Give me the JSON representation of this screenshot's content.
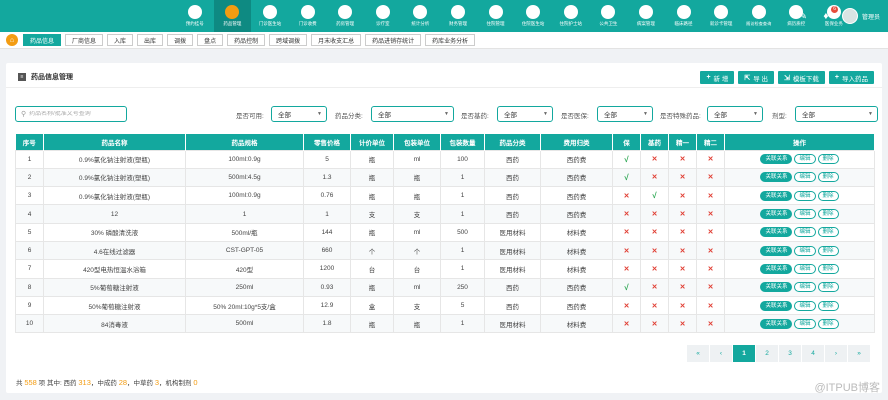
{
  "nav": {
    "items": [
      {
        "label": "预约挂号",
        "icon": "calendar-icon",
        "active": false
      },
      {
        "label": "药品管理",
        "icon": "medicine-icon",
        "active": true
      },
      {
        "label": "门诊医生站",
        "icon": "doctor-icon",
        "active": false
      },
      {
        "label": "门诊收费",
        "icon": "cashier-icon",
        "active": false
      },
      {
        "label": "药房管理",
        "icon": "pharmacy-icon",
        "active": false
      },
      {
        "label": "诊疗室",
        "icon": "clinic-icon",
        "active": false
      },
      {
        "label": "统计分析",
        "icon": "chart-icon",
        "active": false
      },
      {
        "label": "财务管理",
        "icon": "finance-icon",
        "active": false
      },
      {
        "label": "住院管理",
        "icon": "inpatient-icon",
        "active": false
      },
      {
        "label": "住院医生站",
        "icon": "ward-doctor-icon",
        "active": false
      },
      {
        "label": "住院护士站",
        "icon": "nurse-icon",
        "active": false
      },
      {
        "label": "公共卫生",
        "icon": "public-health-icon",
        "active": false
      },
      {
        "label": "病案管理",
        "icon": "records-icon",
        "active": false
      },
      {
        "label": "临床路径",
        "icon": "pathway-icon",
        "active": false
      },
      {
        "label": "就诊卡管理",
        "icon": "card-icon",
        "active": false
      },
      {
        "label": "随访检查查询",
        "icon": "followup-icon",
        "active": false
      },
      {
        "label": "病历质控",
        "icon": "quality-icon",
        "active": false
      },
      {
        "label": "医保业务",
        "icon": "insurance-icon",
        "active": false
      }
    ],
    "notification_count": "6",
    "username": "管理员"
  },
  "tabs": [
    {
      "label": "药品信息",
      "active": true
    },
    {
      "label": "厂商信息",
      "active": false
    },
    {
      "label": "入库",
      "active": false
    },
    {
      "label": "出库",
      "active": false
    },
    {
      "label": "调拨",
      "active": false
    },
    {
      "label": "盘点",
      "active": false
    },
    {
      "label": "药品控制",
      "active": false
    },
    {
      "label": "跨域调拨",
      "active": false
    },
    {
      "label": "月末收支汇总",
      "active": false
    },
    {
      "label": "药品进销存统计",
      "active": false
    },
    {
      "label": "药库业务分析",
      "active": false
    }
  ],
  "panel": {
    "title": "药品信息管理",
    "buttons": {
      "add": "新 增",
      "export": "导 出",
      "template": "模板下载",
      "import": "导入药品"
    }
  },
  "filters": {
    "search_placeholder": "药品名称/批准文号查询",
    "available_label": "是否可用:",
    "available_value": "全部",
    "category_label": "药品分类:",
    "category_value": "全部",
    "essential_label": "是否基药:",
    "essential_value": "全部",
    "insurance_label": "是否医保:",
    "insurance_value": "全部",
    "special_label": "是否特殊药品:",
    "special_value": "全部",
    "form_label": "剂型:",
    "form_value": "全部"
  },
  "table": {
    "headers": [
      "序号",
      "药品名称",
      "药品规格",
      "零售价格",
      "计价单位",
      "包装单位",
      "包装数量",
      "药品分类",
      "费用归类",
      "保",
      "基药",
      "精一",
      "精二",
      "操作"
    ],
    "rows": [
      {
        "no": "1",
        "name": "0.9%氯化钠注射液(塑瓶)",
        "spec": "100ml:0.9g",
        "price": "5",
        "unit": "瓶",
        "pack_unit": "ml",
        "pack_qty": "100",
        "category": "西药",
        "fee": "西药费",
        "ins": true,
        "essential": false,
        "psy1": false,
        "psy2": false
      },
      {
        "no": "2",
        "name": "0.9%氯化钠注射液(塑瓶)",
        "spec": "500ml:4.5g",
        "price": "1.3",
        "unit": "瓶",
        "pack_unit": "瓶",
        "pack_qty": "1",
        "category": "西药",
        "fee": "西药费",
        "ins": true,
        "essential": false,
        "psy1": false,
        "psy2": false
      },
      {
        "no": "3",
        "name": "0.9%氯化钠注射液(塑瓶)",
        "spec": "100ml:0.9g",
        "price": "0.76",
        "unit": "瓶",
        "pack_unit": "瓶",
        "pack_qty": "1",
        "category": "西药",
        "fee": "西药费",
        "ins": false,
        "essential": true,
        "psy1": false,
        "psy2": false
      },
      {
        "no": "4",
        "name": "12",
        "spec": "1",
        "price": "1",
        "unit": "支",
        "pack_unit": "支",
        "pack_qty": "1",
        "category": "西药",
        "fee": "西药费",
        "ins": false,
        "essential": false,
        "psy1": false,
        "psy2": false
      },
      {
        "no": "5",
        "name": "30% 磷酸清洗液",
        "spec": "500ml/瓶",
        "price": "144",
        "unit": "瓶",
        "pack_unit": "ml",
        "pack_qty": "500",
        "category": "医用材料",
        "fee": "材料费",
        "ins": false,
        "essential": false,
        "psy1": false,
        "psy2": false
      },
      {
        "no": "6",
        "name": "4.6在线过滤器",
        "spec": "CST-GPT-05",
        "price": "660",
        "unit": "个",
        "pack_unit": "个",
        "pack_qty": "1",
        "category": "医用材料",
        "fee": "材料费",
        "ins": false,
        "essential": false,
        "psy1": false,
        "psy2": false
      },
      {
        "no": "7",
        "name": "420型电热恒温水浴箱",
        "spec": "420型",
        "price": "1200",
        "unit": "台",
        "pack_unit": "台",
        "pack_qty": "1",
        "category": "医用材料",
        "fee": "材料费",
        "ins": false,
        "essential": false,
        "psy1": false,
        "psy2": false
      },
      {
        "no": "8",
        "name": "5%葡萄糖注射液",
        "spec": "250ml",
        "price": "0.93",
        "unit": "瓶",
        "pack_unit": "ml",
        "pack_qty": "250",
        "category": "西药",
        "fee": "西药费",
        "ins": true,
        "essential": false,
        "psy1": false,
        "psy2": false
      },
      {
        "no": "9",
        "name": "50%葡萄糖注射液",
        "spec": "50% 20ml:10g*5支/盒",
        "price": "12.9",
        "unit": "盒",
        "pack_unit": "支",
        "pack_qty": "5",
        "category": "西药",
        "fee": "西药费",
        "ins": false,
        "essential": false,
        "psy1": false,
        "psy2": false
      },
      {
        "no": "10",
        "name": "84消毒液",
        "spec": "500ml",
        "price": "1.8",
        "unit": "瓶",
        "pack_unit": "瓶",
        "pack_qty": "1",
        "category": "医用材料",
        "fee": "材料费",
        "ins": false,
        "essential": false,
        "psy1": false,
        "psy2": false
      }
    ],
    "op_labels": [
      "关联关系",
      "编辑",
      "删除"
    ]
  },
  "marks": {
    "yes": "√",
    "no": "✕"
  },
  "pagination": {
    "items": [
      "«",
      "‹",
      "1",
      "2",
      "3",
      "4",
      "›",
      "»"
    ],
    "current": "1"
  },
  "summary": {
    "prefix": "共",
    "total": "558",
    "mid1": "项 其中: 西药",
    "western": "313",
    "mid2": "，中成药",
    "chinese_patent": "28",
    "mid3": "，中草药",
    "herbal": "3",
    "mid4": "，机构制剂",
    "institutional": "0"
  },
  "watermark": "@ITPUB博客"
}
